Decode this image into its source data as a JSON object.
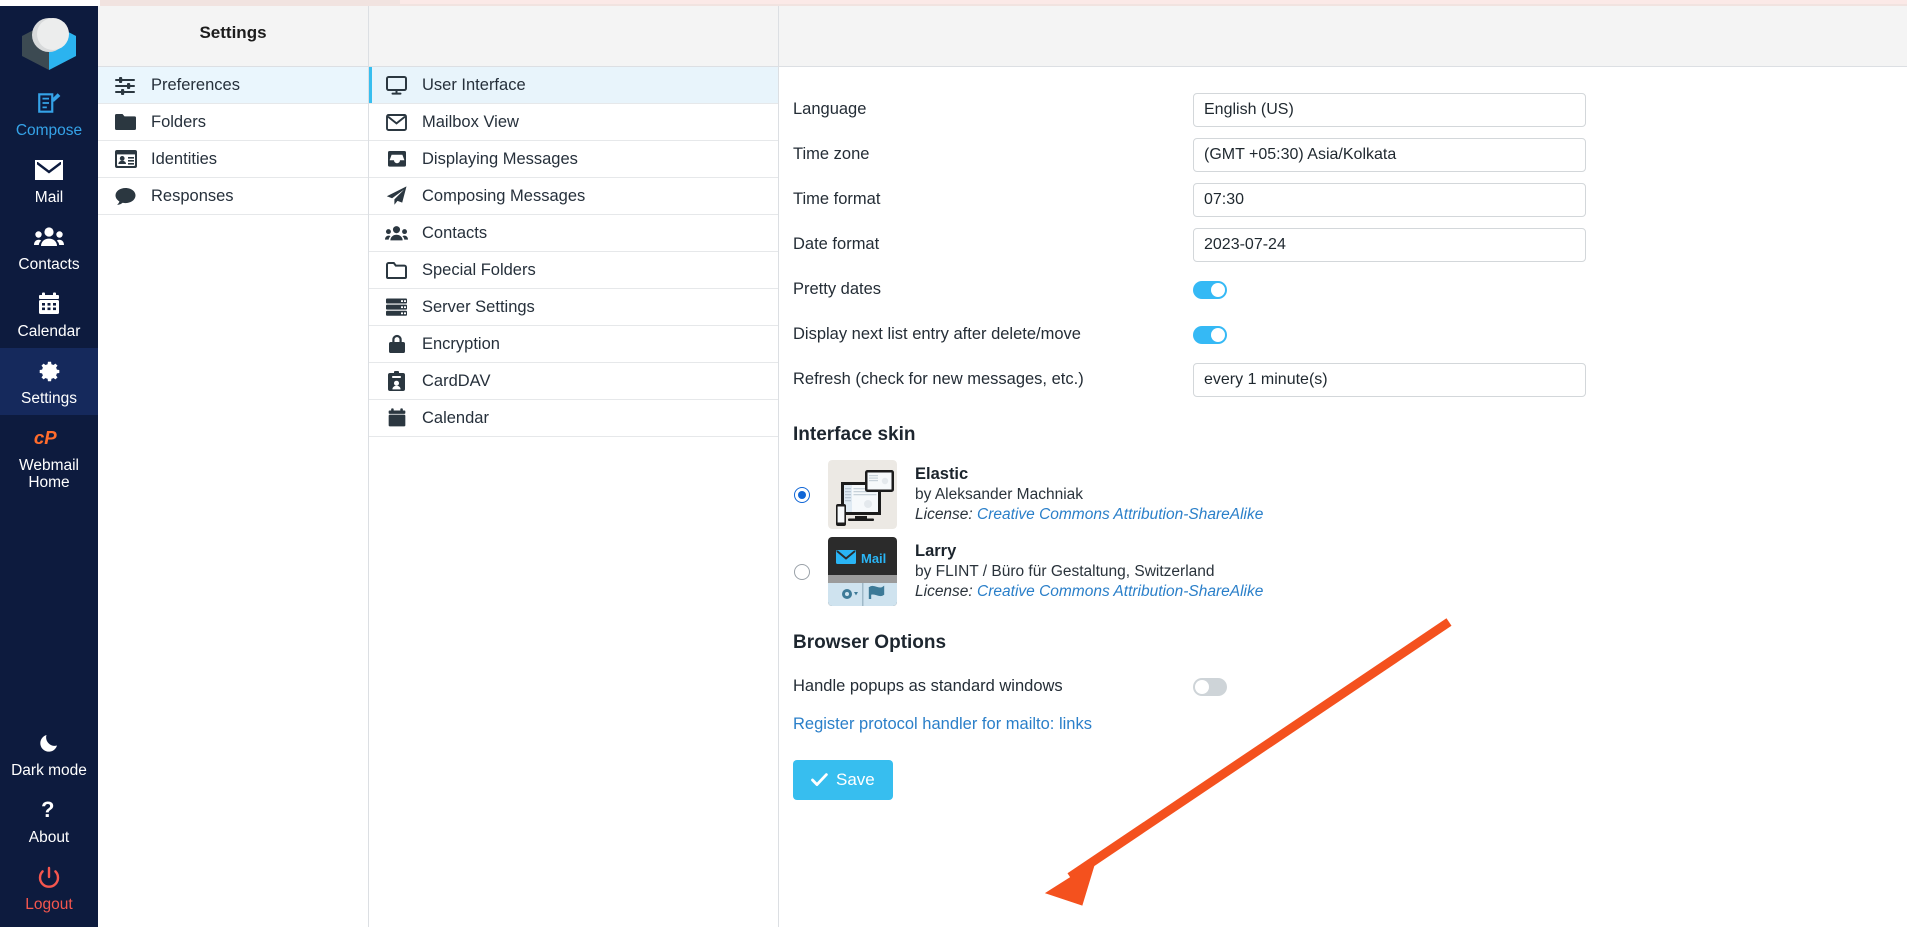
{
  "taskbar": {
    "logo": "roundcube-logo",
    "items": [
      {
        "label": "Compose",
        "icon": "compose-icon",
        "state": "compose"
      },
      {
        "label": "Mail",
        "icon": "envelope-icon",
        "state": "normal"
      },
      {
        "label": "Contacts",
        "icon": "contacts-icon",
        "state": "normal"
      },
      {
        "label": "Calendar",
        "icon": "calendar-icon",
        "state": "normal"
      },
      {
        "label": "Settings",
        "icon": "gear-icon",
        "state": "selected"
      },
      {
        "label": "Webmail Home",
        "icon": "cpanel-icon",
        "state": "normal"
      }
    ],
    "bottom": [
      {
        "label": "Dark mode",
        "icon": "moon-icon"
      },
      {
        "label": "About",
        "icon": "question-icon"
      },
      {
        "label": "Logout",
        "icon": "power-icon"
      }
    ]
  },
  "settings_column": {
    "header": "Settings",
    "items": [
      {
        "label": "Preferences",
        "icon": "sliders-icon",
        "active": true
      },
      {
        "label": "Folders",
        "icon": "folder-icon",
        "active": false
      },
      {
        "label": "Identities",
        "icon": "id-card-icon",
        "active": false
      },
      {
        "label": "Responses",
        "icon": "comment-icon",
        "active": false
      }
    ]
  },
  "sections_column": {
    "header": "",
    "items": [
      {
        "label": "User Interface",
        "icon": "monitor-icon",
        "active": true
      },
      {
        "label": "Mailbox View",
        "icon": "envelope-icon",
        "active": false
      },
      {
        "label": "Displaying Messages",
        "icon": "inbox-icon",
        "active": false
      },
      {
        "label": "Composing Messages",
        "icon": "paper-plane-icon",
        "active": false
      },
      {
        "label": "Contacts",
        "icon": "contacts-icon",
        "active": false
      },
      {
        "label": "Special Folders",
        "icon": "folder-open-icon",
        "active": false
      },
      {
        "label": "Server Settings",
        "icon": "server-icon",
        "active": false
      },
      {
        "label": "Encryption",
        "icon": "lock-icon",
        "active": false
      },
      {
        "label": "CardDAV",
        "icon": "id-badge-icon",
        "active": false
      },
      {
        "label": "Calendar",
        "icon": "calendar-icon",
        "active": false
      }
    ]
  },
  "content": {
    "header": "",
    "fields": [
      {
        "label": "Language",
        "type": "select",
        "value": "English (US)"
      },
      {
        "label": "Time zone",
        "type": "select",
        "value": "(GMT +05:30) Asia/Kolkata"
      },
      {
        "label": "Time format",
        "type": "select",
        "value": "07:30"
      },
      {
        "label": "Date format",
        "type": "select",
        "value": "2023-07-24"
      },
      {
        "label": "Pretty dates",
        "type": "toggle",
        "value": "on"
      },
      {
        "label": "Display next list entry after delete/move",
        "type": "toggle",
        "value": "on"
      },
      {
        "label": "Refresh (check for new messages, etc.)",
        "type": "select",
        "value": "every 1 minute(s)"
      }
    ],
    "interface_skin": {
      "title": "Interface skin",
      "skins": [
        {
          "name": "Elastic",
          "author": "by Aleksander Machniak",
          "license_label": "License:",
          "license_link": "Creative Commons Attribution-ShareAlike",
          "selected": true
        },
        {
          "name": "Larry",
          "author": "by FLINT / Büro für Gestaltung, Switzerland",
          "license_label": "License:",
          "license_link": "Creative Commons Attribution-ShareAlike",
          "selected": false,
          "thumb_text": "Mail"
        }
      ]
    },
    "browser_options": {
      "title": "Browser Options",
      "popup_label": "Handle popups as standard windows",
      "popup_value": "off",
      "protocol_handler_link": "Register protocol handler for mailto: links"
    },
    "save_button": "Save",
    "accent_color": "#37beef",
    "annotation_arrow_color": "#f4511e"
  }
}
